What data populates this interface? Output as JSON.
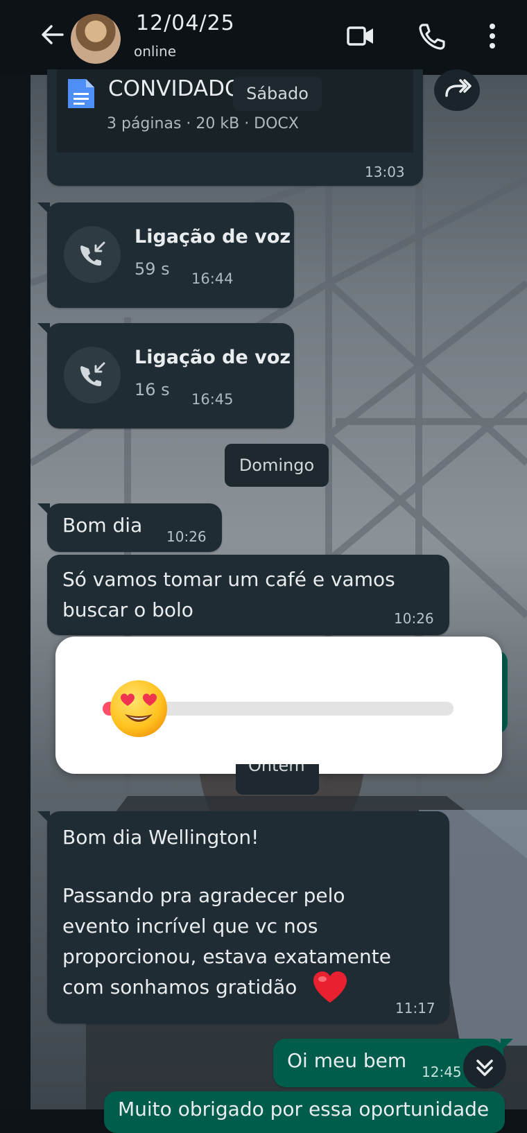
{
  "header": {
    "contact_name": "12/04/25",
    "status": "online"
  },
  "messages": {
    "document": {
      "title": "CONVIDADO",
      "meta": "3 páginas · 20 kB · DOCX",
      "time": "13:03"
    },
    "date_chip_1": "Sábado",
    "call_1": {
      "title": "Ligação de voz",
      "duration": "59 s",
      "time": "16:44"
    },
    "call_2": {
      "title": "Ligação de voz",
      "duration": "16 s",
      "time": "16:45"
    },
    "date_chip_2": "Domingo",
    "msg_1": {
      "text": "Bom dia",
      "time": "10:26"
    },
    "msg_2": {
      "line1": "Só vamos tomar um café e vamos",
      "line2": "buscar o  bolo",
      "time": "10:26"
    },
    "date_chip_3": "Ontem",
    "msg_3": {
      "line1": "Bom dia Wellington!",
      "line2": "Passando pra agradecer pelo",
      "line3": "evento incrível que vc nos",
      "line4": "proporcionou, estava exatamente",
      "line5": "com sonhamos gratidão",
      "emoji": "❤️",
      "time": "11:17"
    },
    "msg_out_1": {
      "text": "Oi meu bem",
      "time": "12:45"
    },
    "msg_out_2_partial": "Muito obrigado por essa oportunidade"
  },
  "reaction_slider": {
    "emoji": "😍",
    "level": 0.02
  },
  "colors": {
    "header_bg": "#0c1216",
    "incoming_bubble": "#202c33",
    "outgoing_bubble": "#005c4b",
    "accent_red": "#ff4d6a"
  },
  "icons": [
    "back-arrow-icon",
    "video-call-icon",
    "phone-icon",
    "more-options-icon",
    "document-icon",
    "forward-icon",
    "incoming-call-icon",
    "scroll-down-icon"
  ]
}
